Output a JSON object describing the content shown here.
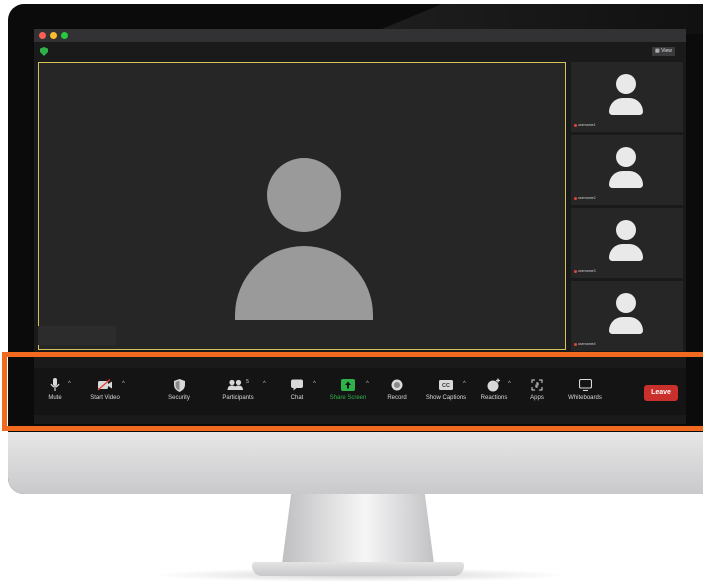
{
  "window": {
    "traffic_lights": [
      "#ff5f57",
      "#febc2e",
      "#28c840"
    ],
    "view_label": "View"
  },
  "participants": {
    "main_speaker_icon": "person-avatar-icon",
    "thumbnail_names": [
      "username1",
      "username2",
      "username3",
      "username4"
    ]
  },
  "toolbar": {
    "mute_label": "Mute",
    "start_video_label": "Start Video",
    "security_label": "Security",
    "participants_label": "Participants",
    "participants_count": "5",
    "chat_label": "Chat",
    "share_screen_label": "Share Screen",
    "record_label": "Record",
    "show_captions_label": "Show Captions",
    "reactions_label": "Reactions",
    "apps_label": "Apps",
    "whiteboards_label": "Whiteboards",
    "leave_label": "Leave"
  },
  "colors": {
    "highlight": "#f26a1f",
    "share_screen": "#2fb14a",
    "leave": "#c9302c",
    "active_speaker_border": "#d6c25a"
  }
}
